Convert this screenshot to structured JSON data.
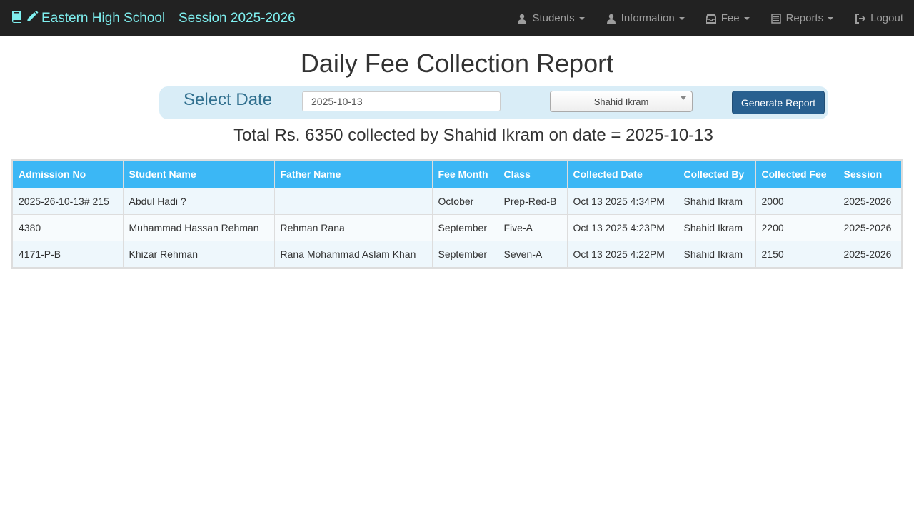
{
  "navbar": {
    "school_name": "Eastern High School",
    "session": "Session 2025-2026",
    "menu": [
      {
        "label": "Students",
        "icon": "user-icon"
      },
      {
        "label": "Information",
        "icon": "user-icon"
      },
      {
        "label": "Fee",
        "icon": "inbox-icon"
      },
      {
        "label": "Reports",
        "icon": "list-alt-icon"
      },
      {
        "label": "Logout",
        "icon": "logout-icon"
      }
    ]
  },
  "page": {
    "title": "Daily Fee Collection Report"
  },
  "filter": {
    "select_date_label": "Select Date",
    "date_value": "2025-10-13",
    "collector_selected": "Shahid Ikram",
    "generate_button": "Generate Report"
  },
  "summary": {
    "total_text": "Total Rs. 6350 collected by Shahid Ikram on date = 2025-10-13"
  },
  "table": {
    "headers": [
      "Admission No",
      "Student Name",
      "Father Name",
      "Fee Month",
      "Class",
      "Collected Date",
      "Collected By",
      "Collected Fee",
      "Session"
    ],
    "rows": [
      [
        "2025-26-10-13# 215",
        "Abdul Hadi ?",
        "",
        "October",
        "Prep-Red-B",
        "Oct 13 2025 4:34PM",
        "Shahid Ikram",
        "2000",
        "2025-2026"
      ],
      [
        "4380",
        "Muhammad Hassan Rehman",
        "Rehman Rana",
        "September",
        "Five-A",
        "Oct 13 2025 4:23PM",
        "Shahid Ikram",
        "2200",
        "2025-2026"
      ],
      [
        "4171-P-B",
        "Khizar Rehman",
        "Rana Mohammad Aslam Khan",
        "September",
        "Seven-A",
        "Oct 13 2025 4:22PM",
        "Shahid Ikram",
        "2150",
        "2025-2026"
      ]
    ]
  },
  "colors": {
    "navbar_bg": "#222222",
    "brand_text": "#7ff0f0",
    "table_header_bg": "#3bb7f5",
    "filter_bar_bg": "#d9edf7",
    "primary_button": "#286090"
  }
}
